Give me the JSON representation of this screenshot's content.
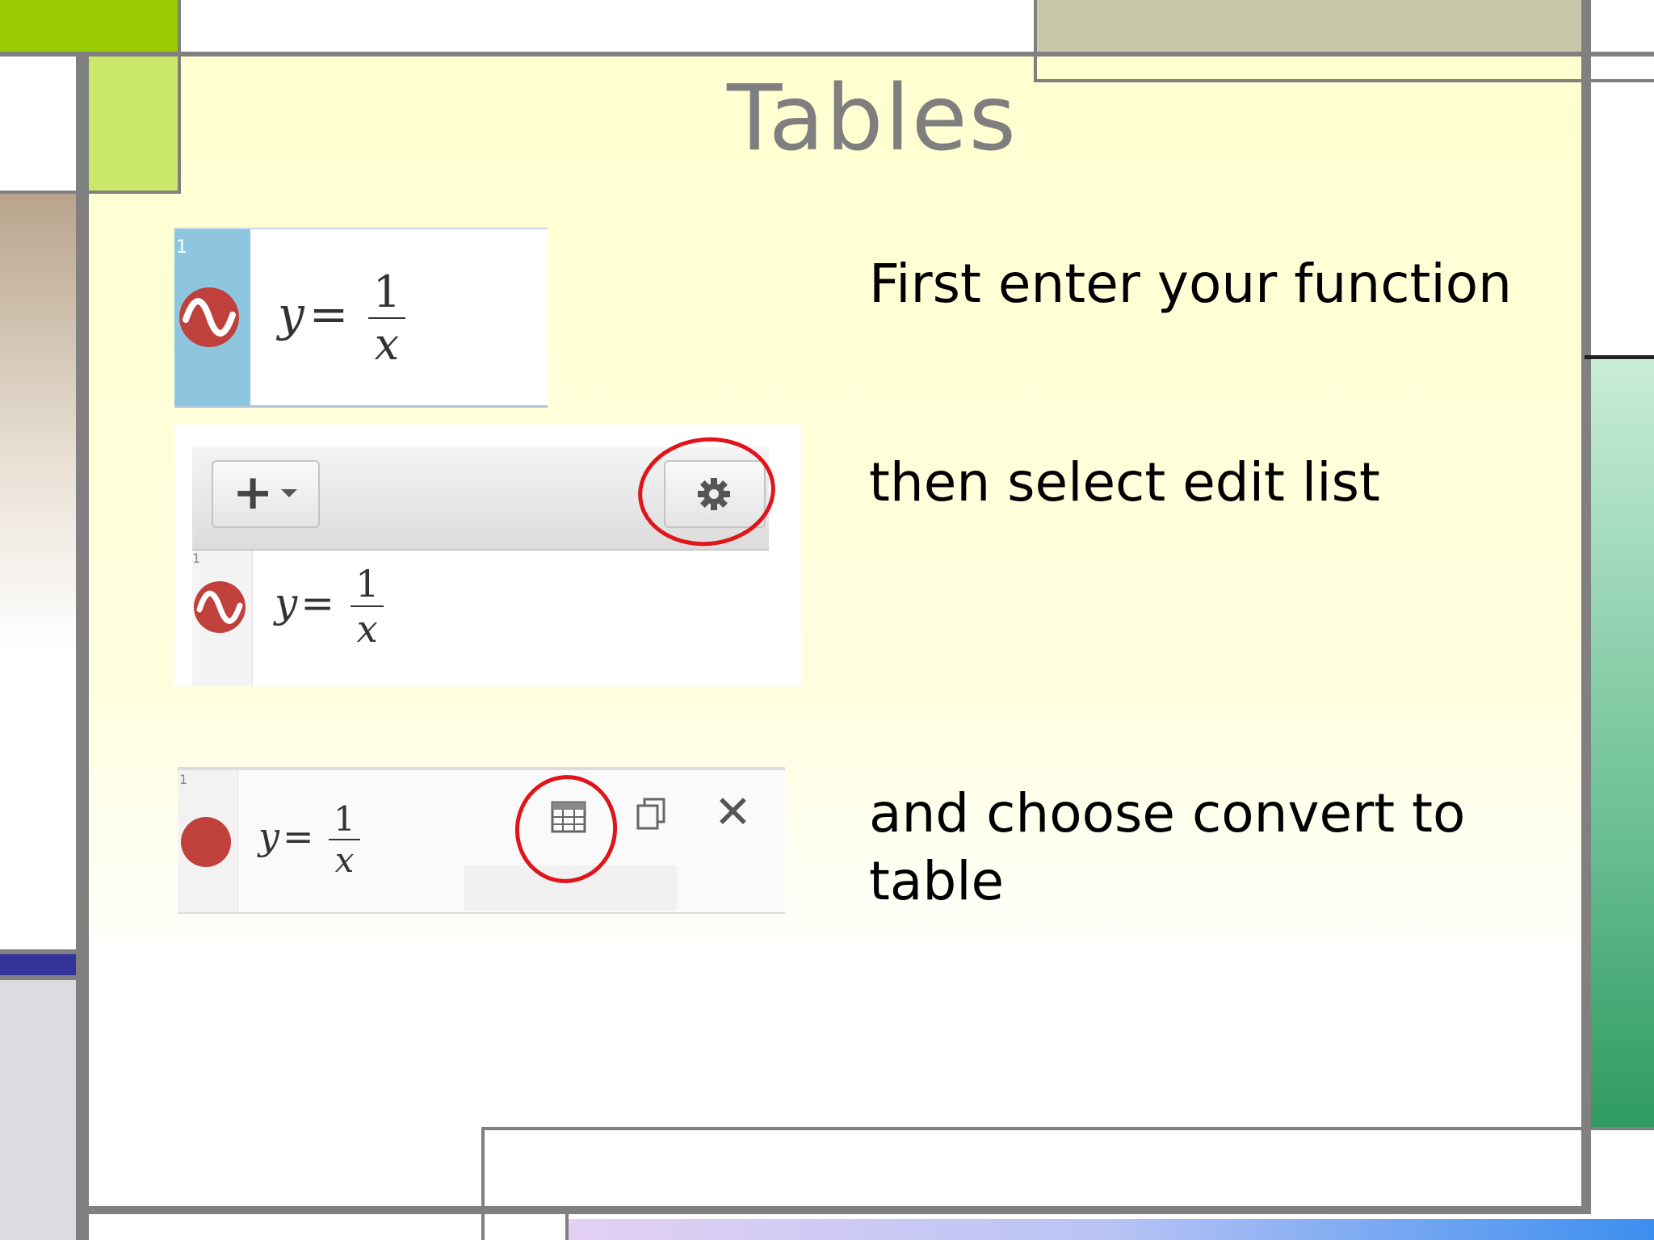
{
  "slide": {
    "title": "Tables",
    "steps": [
      {
        "caption": "First enter your function"
      },
      {
        "caption": "then select edit list"
      },
      {
        "caption": "and choose convert to table"
      }
    ]
  },
  "panels": {
    "panel1": {
      "row_number": "1",
      "equation_lhs": "y",
      "equation_eq": "=",
      "numerator": "1",
      "denominator": "x"
    },
    "panel2": {
      "add_button_label": "+",
      "row_number": "1",
      "equation_lhs": "y",
      "equation_eq": "=",
      "numerator": "1",
      "denominator": "x"
    },
    "panel3": {
      "row_number": "1",
      "equation_lhs": "y",
      "equation_eq": "=",
      "numerator": "1",
      "denominator": "x",
      "close_glyph": "✕"
    }
  },
  "colors": {
    "title_gray": "#7f7f7f",
    "accent_green": "#99cc00",
    "light_green": "#cce86a",
    "olive": "#c8c8a8",
    "brown_gradient_top": "#b8a48c",
    "navy": "#333399",
    "teal_gradient": "#2e9a60",
    "graph_icon_red": "#c0403c",
    "annotation_red": "#e0141a",
    "row_highlight_blue": "#8ec6e0"
  },
  "icons": [
    "wave-function-icon",
    "gear-icon",
    "plus-dropdown-icon",
    "table-icon",
    "duplicate-icon",
    "close-icon"
  ]
}
